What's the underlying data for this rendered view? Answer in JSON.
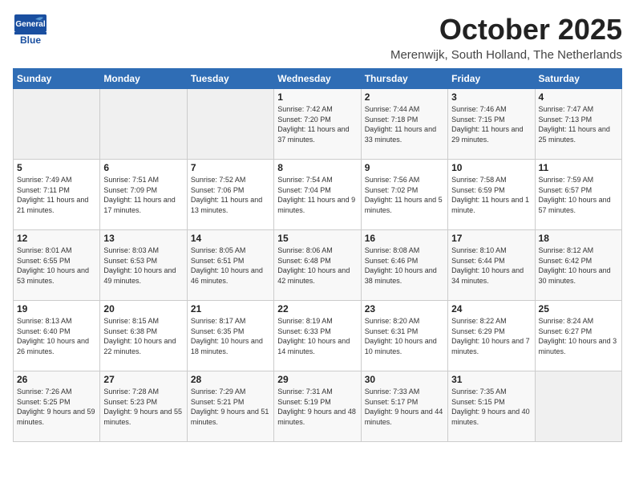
{
  "header": {
    "logo_top": "General",
    "logo_bottom": "Blue",
    "month": "October 2025",
    "location": "Merenwijk, South Holland, The Netherlands"
  },
  "weekdays": [
    "Sunday",
    "Monday",
    "Tuesday",
    "Wednesday",
    "Thursday",
    "Friday",
    "Saturday"
  ],
  "weeks": [
    [
      {
        "day": "",
        "sunrise": "",
        "sunset": "",
        "daylight": "",
        "empty": true
      },
      {
        "day": "",
        "sunrise": "",
        "sunset": "",
        "daylight": "",
        "empty": true
      },
      {
        "day": "",
        "sunrise": "",
        "sunset": "",
        "daylight": "",
        "empty": true
      },
      {
        "day": "1",
        "sunrise": "Sunrise: 7:42 AM",
        "sunset": "Sunset: 7:20 PM",
        "daylight": "Daylight: 11 hours and 37 minutes."
      },
      {
        "day": "2",
        "sunrise": "Sunrise: 7:44 AM",
        "sunset": "Sunset: 7:18 PM",
        "daylight": "Daylight: 11 hours and 33 minutes."
      },
      {
        "day": "3",
        "sunrise": "Sunrise: 7:46 AM",
        "sunset": "Sunset: 7:15 PM",
        "daylight": "Daylight: 11 hours and 29 minutes."
      },
      {
        "day": "4",
        "sunrise": "Sunrise: 7:47 AM",
        "sunset": "Sunset: 7:13 PM",
        "daylight": "Daylight: 11 hours and 25 minutes."
      }
    ],
    [
      {
        "day": "5",
        "sunrise": "Sunrise: 7:49 AM",
        "sunset": "Sunset: 7:11 PM",
        "daylight": "Daylight: 11 hours and 21 minutes."
      },
      {
        "day": "6",
        "sunrise": "Sunrise: 7:51 AM",
        "sunset": "Sunset: 7:09 PM",
        "daylight": "Daylight: 11 hours and 17 minutes."
      },
      {
        "day": "7",
        "sunrise": "Sunrise: 7:52 AM",
        "sunset": "Sunset: 7:06 PM",
        "daylight": "Daylight: 11 hours and 13 minutes."
      },
      {
        "day": "8",
        "sunrise": "Sunrise: 7:54 AM",
        "sunset": "Sunset: 7:04 PM",
        "daylight": "Daylight: 11 hours and 9 minutes."
      },
      {
        "day": "9",
        "sunrise": "Sunrise: 7:56 AM",
        "sunset": "Sunset: 7:02 PM",
        "daylight": "Daylight: 11 hours and 5 minutes."
      },
      {
        "day": "10",
        "sunrise": "Sunrise: 7:58 AM",
        "sunset": "Sunset: 6:59 PM",
        "daylight": "Daylight: 11 hours and 1 minute."
      },
      {
        "day": "11",
        "sunrise": "Sunrise: 7:59 AM",
        "sunset": "Sunset: 6:57 PM",
        "daylight": "Daylight: 10 hours and 57 minutes."
      }
    ],
    [
      {
        "day": "12",
        "sunrise": "Sunrise: 8:01 AM",
        "sunset": "Sunset: 6:55 PM",
        "daylight": "Daylight: 10 hours and 53 minutes."
      },
      {
        "day": "13",
        "sunrise": "Sunrise: 8:03 AM",
        "sunset": "Sunset: 6:53 PM",
        "daylight": "Daylight: 10 hours and 49 minutes."
      },
      {
        "day": "14",
        "sunrise": "Sunrise: 8:05 AM",
        "sunset": "Sunset: 6:51 PM",
        "daylight": "Daylight: 10 hours and 46 minutes."
      },
      {
        "day": "15",
        "sunrise": "Sunrise: 8:06 AM",
        "sunset": "Sunset: 6:48 PM",
        "daylight": "Daylight: 10 hours and 42 minutes."
      },
      {
        "day": "16",
        "sunrise": "Sunrise: 8:08 AM",
        "sunset": "Sunset: 6:46 PM",
        "daylight": "Daylight: 10 hours and 38 minutes."
      },
      {
        "day": "17",
        "sunrise": "Sunrise: 8:10 AM",
        "sunset": "Sunset: 6:44 PM",
        "daylight": "Daylight: 10 hours and 34 minutes."
      },
      {
        "day": "18",
        "sunrise": "Sunrise: 8:12 AM",
        "sunset": "Sunset: 6:42 PM",
        "daylight": "Daylight: 10 hours and 30 minutes."
      }
    ],
    [
      {
        "day": "19",
        "sunrise": "Sunrise: 8:13 AM",
        "sunset": "Sunset: 6:40 PM",
        "daylight": "Daylight: 10 hours and 26 minutes."
      },
      {
        "day": "20",
        "sunrise": "Sunrise: 8:15 AM",
        "sunset": "Sunset: 6:38 PM",
        "daylight": "Daylight: 10 hours and 22 minutes."
      },
      {
        "day": "21",
        "sunrise": "Sunrise: 8:17 AM",
        "sunset": "Sunset: 6:35 PM",
        "daylight": "Daylight: 10 hours and 18 minutes."
      },
      {
        "day": "22",
        "sunrise": "Sunrise: 8:19 AM",
        "sunset": "Sunset: 6:33 PM",
        "daylight": "Daylight: 10 hours and 14 minutes."
      },
      {
        "day": "23",
        "sunrise": "Sunrise: 8:20 AM",
        "sunset": "Sunset: 6:31 PM",
        "daylight": "Daylight: 10 hours and 10 minutes."
      },
      {
        "day": "24",
        "sunrise": "Sunrise: 8:22 AM",
        "sunset": "Sunset: 6:29 PM",
        "daylight": "Daylight: 10 hours and 7 minutes."
      },
      {
        "day": "25",
        "sunrise": "Sunrise: 8:24 AM",
        "sunset": "Sunset: 6:27 PM",
        "daylight": "Daylight: 10 hours and 3 minutes."
      }
    ],
    [
      {
        "day": "26",
        "sunrise": "Sunrise: 7:26 AM",
        "sunset": "Sunset: 5:25 PM",
        "daylight": "Daylight: 9 hours and 59 minutes."
      },
      {
        "day": "27",
        "sunrise": "Sunrise: 7:28 AM",
        "sunset": "Sunset: 5:23 PM",
        "daylight": "Daylight: 9 hours and 55 minutes."
      },
      {
        "day": "28",
        "sunrise": "Sunrise: 7:29 AM",
        "sunset": "Sunset: 5:21 PM",
        "daylight": "Daylight: 9 hours and 51 minutes."
      },
      {
        "day": "29",
        "sunrise": "Sunrise: 7:31 AM",
        "sunset": "Sunset: 5:19 PM",
        "daylight": "Daylight: 9 hours and 48 minutes."
      },
      {
        "day": "30",
        "sunrise": "Sunrise: 7:33 AM",
        "sunset": "Sunset: 5:17 PM",
        "daylight": "Daylight: 9 hours and 44 minutes."
      },
      {
        "day": "31",
        "sunrise": "Sunrise: 7:35 AM",
        "sunset": "Sunset: 5:15 PM",
        "daylight": "Daylight: 9 hours and 40 minutes."
      },
      {
        "day": "",
        "sunrise": "",
        "sunset": "",
        "daylight": "",
        "empty": true
      }
    ]
  ]
}
